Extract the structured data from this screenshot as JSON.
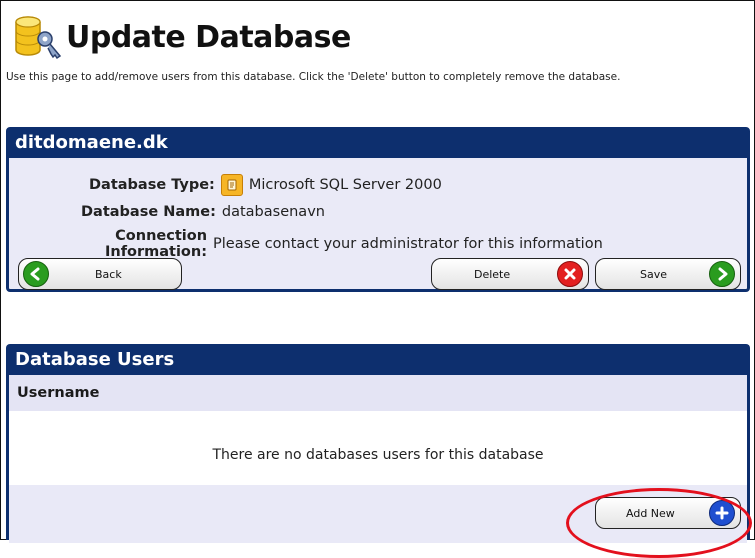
{
  "page": {
    "title": "Update Database",
    "description": "Use this page to add/remove users from this database. Click the 'Delete' button to completely remove the database."
  },
  "database_panel": {
    "heading": "ditdomaene.dk",
    "type_label": "Database Type:",
    "type_value": "Microsoft SQL Server 2000",
    "name_label": "Database Name:",
    "name_value": "databasenavn",
    "connection_label_line1": "Connection",
    "connection_label_line2": "Information:",
    "connection_value": "Please contact your administrator for this information",
    "back_button": "Back",
    "delete_button": "Delete",
    "save_button": "Save"
  },
  "users_panel": {
    "heading": "Database Users",
    "column_username": "Username",
    "empty_message": "There are no databases users for this database",
    "add_new_button": "Add New"
  },
  "colors": {
    "panel_header": "#0d2f6e",
    "panel_body": "#eaeaf7",
    "green_button": "#2a9c1f",
    "red_button": "#e32020",
    "blue_button": "#1f4fd0",
    "highlight": "#e3101d"
  },
  "icons": {
    "header": "database-key-icon",
    "type": "sql-server-icon",
    "back": "arrow-left-icon",
    "delete": "x-circle-icon",
    "save": "arrow-right-icon",
    "add": "plus-circle-icon"
  }
}
